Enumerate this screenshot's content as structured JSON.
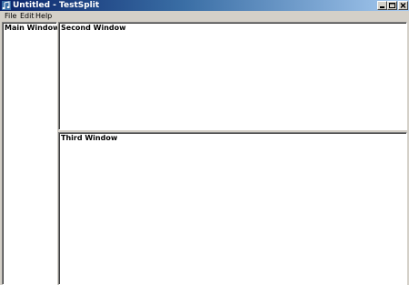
{
  "window": {
    "title": "Untitled - TestSplit",
    "app_icon": "music-note-icon",
    "caption_buttons": [
      "minimize-icon",
      "maximize-icon",
      "close-icon"
    ]
  },
  "menubar": {
    "items": [
      "File",
      "Edit",
      "Help"
    ]
  },
  "panes": {
    "main": {
      "label": "Main Window"
    },
    "second": {
      "label": "Second Window"
    },
    "third": {
      "label": "Third Window"
    }
  },
  "colors": {
    "titlebar_start": "#0a246a",
    "titlebar_end": "#a6caf0",
    "chrome": "#d4d0c8",
    "pane_background": "#ffffff"
  }
}
